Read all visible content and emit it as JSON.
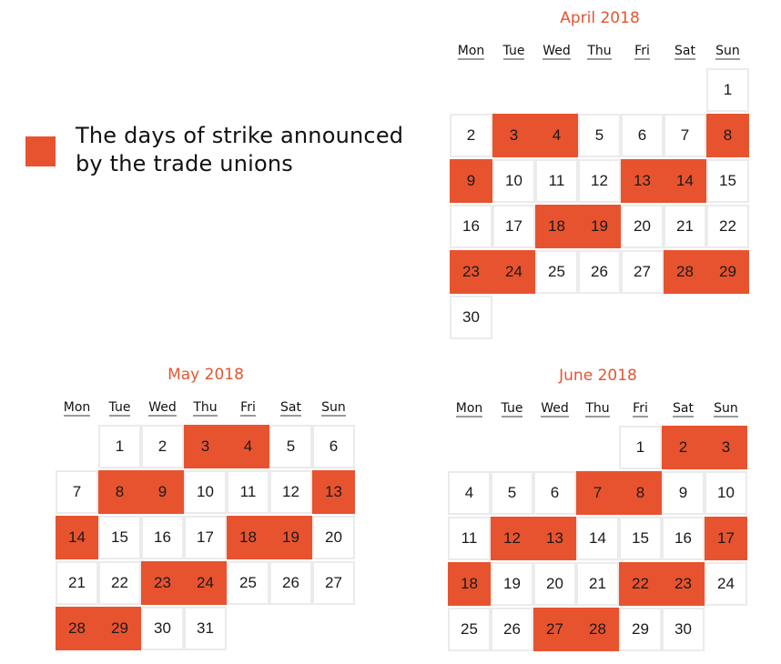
{
  "legend": {
    "text": "The days of strike announced by the trade unions",
    "color": "#E8532F"
  },
  "colors": {
    "strike": "#E8532F",
    "title": "#E8532F",
    "cell_border": "#EBEBEB"
  },
  "weekdays": [
    "Mon",
    "Tue",
    "Wed",
    "Thu",
    "Fri",
    "Sat",
    "Sun"
  ],
  "months": [
    {
      "id": "april",
      "title": "April 2018",
      "first_weekday_index": 6,
      "days_in_month": 30,
      "strike_days": [
        3,
        4,
        8,
        9,
        13,
        14,
        18,
        19,
        23,
        24,
        28,
        29
      ]
    },
    {
      "id": "may",
      "title": "May 2018",
      "first_weekday_index": 1,
      "days_in_month": 31,
      "strike_days": [
        3,
        4,
        8,
        9,
        13,
        14,
        18,
        19,
        23,
        24,
        28,
        29
      ]
    },
    {
      "id": "june",
      "title": "June 2018",
      "first_weekday_index": 4,
      "days_in_month": 30,
      "strike_days": [
        2,
        3,
        7,
        8,
        12,
        13,
        17,
        18,
        22,
        23,
        27,
        28
      ]
    }
  ]
}
